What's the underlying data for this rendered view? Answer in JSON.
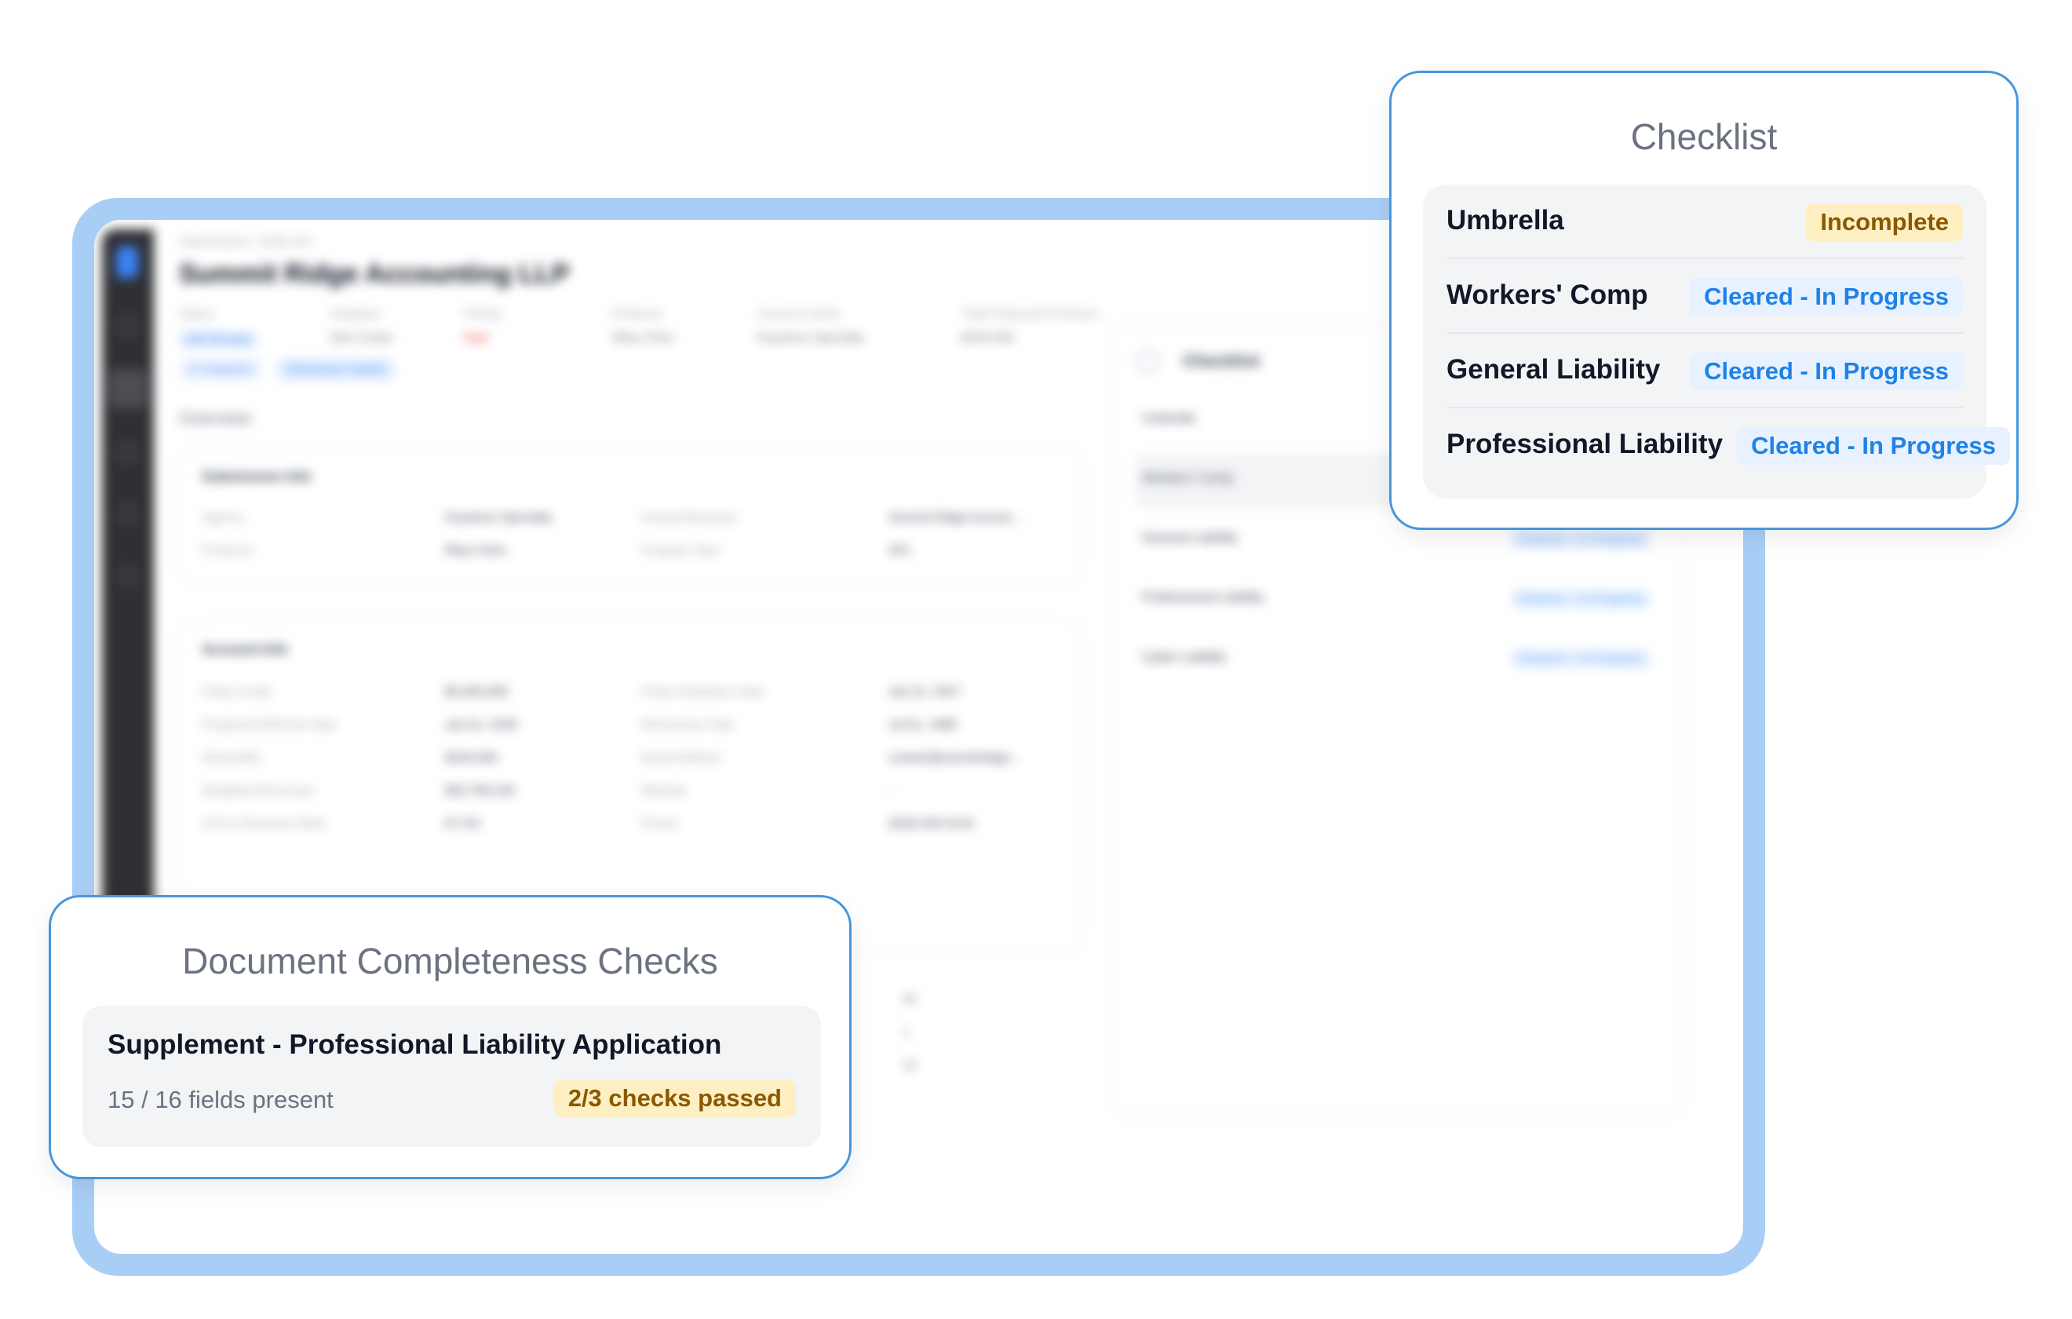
{
  "app": {
    "breadcrumb": "Submissions / SUB-143",
    "title": "Summit Ridge Accounting LLP",
    "meta": [
      {
        "label": "Status",
        "value": "UW Review"
      },
      {
        "label": "Assignee",
        "value": "Sam Carter"
      },
      {
        "label": "Priority",
        "value": "High"
      },
      {
        "label": "Producer",
        "value": "Riley Chen"
      },
      {
        "label": "Current Carrier",
        "value": "Keystone Specialty"
      },
      {
        "label": "Total Proposed Premium",
        "value": "$100,000"
      }
    ],
    "pills": [
      "AI Snapshot",
      "Submission Details"
    ],
    "overview_label": "Overview",
    "submission_info": {
      "title": "Submission Info",
      "rows": [
        [
          "Agency",
          "Keystone Specialty",
          "Insured Business",
          "Summit Ridge Accoun..."
        ],
        [
          "Producer",
          "Riley Chen",
          "Program Type",
          "APL"
        ]
      ]
    },
    "account_info": {
      "title": "Account Info",
      "rows": [
        [
          "Policy Limits",
          "$5,000,000",
          "Policy Expiration Date",
          "Jan 01, 2027"
        ],
        [
          "Proposed Effective Date",
          "Jan 01, 2026",
          "Retroactive Date",
          "Jul 01, 1986"
        ],
        [
          "Deductible",
          "$100,000",
          "Email Address",
          "contact@summitridge..."
        ],
        [
          "Weighted Revenues",
          "$35,780,240",
          "Website",
          "-"
        ],
        [
          "CPA in Revenue Ratio",
          "67.5%",
          "Phone",
          "(818) 555-0142"
        ]
      ]
    },
    "stats": [
      "40",
      "1",
      "22"
    ],
    "checklist": {
      "title": "Checklist",
      "items": [
        {
          "name": "Umbrella",
          "status": ""
        },
        {
          "name": "Workers' Comp",
          "status": ""
        },
        {
          "name": "General Liability",
          "status": "Cleared - In Progress"
        },
        {
          "name": "Professional Liability",
          "status": "Cleared - In Progress"
        },
        {
          "name": "Cyber Liability",
          "status": "Cleared - In Progress"
        }
      ]
    }
  },
  "checklist_callout": {
    "title": "Checklist",
    "items": [
      {
        "name": "Umbrella",
        "status": "Incomplete"
      },
      {
        "name": "Workers' Comp",
        "status": "Cleared - In Progress"
      },
      {
        "name": "General Liability",
        "status": "Cleared - In Progress"
      },
      {
        "name": "Professional Liability",
        "status": "Cleared - In Progress"
      }
    ]
  },
  "document_callout": {
    "title": "Document Completeness Checks",
    "document": {
      "name": "Supplement - Professional Liability Application",
      "fields": "15 / 16 fields present",
      "checks": "2/3 checks passed"
    }
  },
  "colors": {
    "frame": "#a9cef6",
    "callout_border": "#4796dc",
    "incomplete_bg": "#fdefc1",
    "incomplete_text": "#8a5800",
    "progress_bg": "#e7f1ff",
    "progress_text": "#1f82e6"
  }
}
